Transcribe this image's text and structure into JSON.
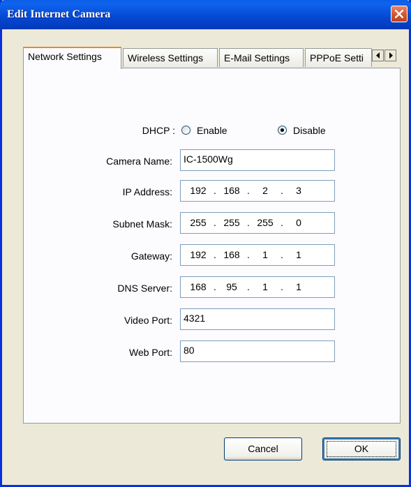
{
  "window": {
    "title": "Edit Internet Camera"
  },
  "tabs": [
    {
      "label": "Network Settings",
      "active": true
    },
    {
      "label": "Wireless Settings",
      "active": false
    },
    {
      "label": "E-Mail Settings",
      "active": false
    },
    {
      "label": "PPPoE Setti",
      "active": false
    }
  ],
  "form": {
    "dhcp": {
      "label": "DHCP :",
      "enable_label": "Enable",
      "disable_label": "Disable",
      "selected": "Disable"
    },
    "camera_name": {
      "label": "Camera Name:",
      "value": "IC-1500Wg"
    },
    "ip_address": {
      "label": "IP Address:",
      "octets": [
        "192",
        "168",
        "2",
        "3"
      ]
    },
    "subnet_mask": {
      "label": "Subnet Mask:",
      "octets": [
        "255",
        "255",
        "255",
        "0"
      ]
    },
    "gateway": {
      "label": "Gateway:",
      "octets": [
        "192",
        "168",
        "1",
        "1"
      ]
    },
    "dns_server": {
      "label": "DNS Server:",
      "octets": [
        "168",
        "95",
        "1",
        "1"
      ]
    },
    "video_port": {
      "label": "Video Port:",
      "value": "4321"
    },
    "web_port": {
      "label": "Web Port:",
      "value": "80"
    },
    "ip_dot": "."
  },
  "buttons": {
    "cancel": "Cancel",
    "ok": "OK"
  },
  "icons": {
    "close": "close-icon",
    "scroll_left": "arrow-left-icon",
    "scroll_right": "arrow-right-icon"
  },
  "colors": {
    "titlebar": "#0448d2",
    "close": "#d2552f",
    "tab_highlight": "#e68b2c",
    "face": "#ece9d8"
  }
}
